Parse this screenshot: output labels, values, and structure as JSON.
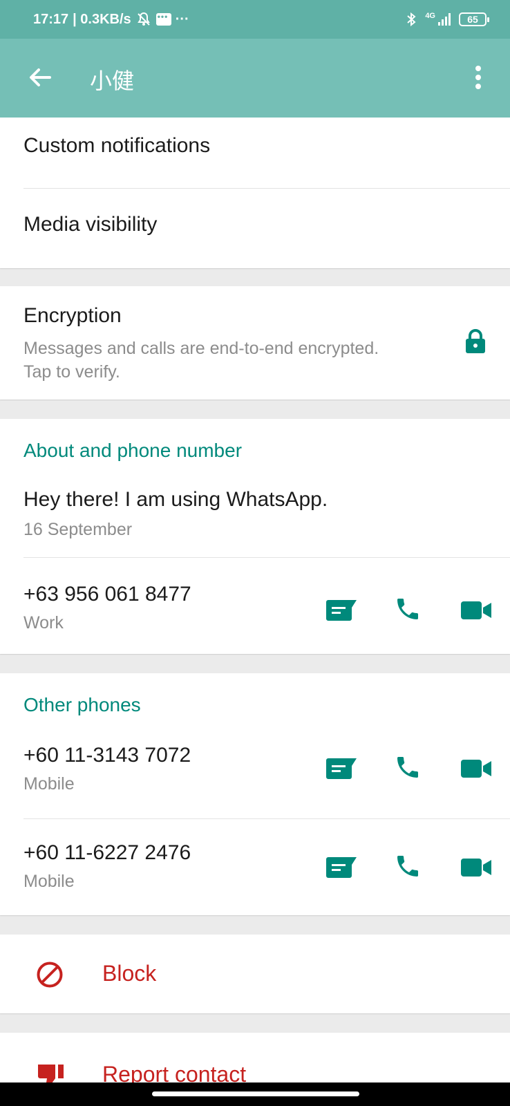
{
  "status_bar": {
    "time": "17:17",
    "speed": "| 0.3KB/s",
    "dots": "···",
    "network": "4G",
    "battery": "65"
  },
  "app_bar": {
    "title": "小健"
  },
  "settings": {
    "custom_notifications": "Custom notifications",
    "media_visibility": "Media visibility"
  },
  "encryption": {
    "title": "Encryption",
    "line1": "Messages and calls are end-to-end encrypted.",
    "line2": "Tap to verify."
  },
  "about": {
    "heading": "About and phone number",
    "status": "Hey there! I am using WhatsApp.",
    "date": "16 September",
    "phone": "+63 956 061 8477",
    "phone_type": "Work"
  },
  "other_phones": {
    "heading": "Other phones",
    "items": [
      {
        "number": "+60 11-3143 7072",
        "type": "Mobile"
      },
      {
        "number": "+60 11-6227 2476",
        "type": "Mobile"
      }
    ]
  },
  "block": {
    "label": "Block"
  },
  "report": {
    "label": "Report contact"
  },
  "colors": {
    "accent": "#00897b",
    "toolbar": "#75bfb6",
    "status": "#5fb1a6",
    "danger": "#c6221f"
  }
}
